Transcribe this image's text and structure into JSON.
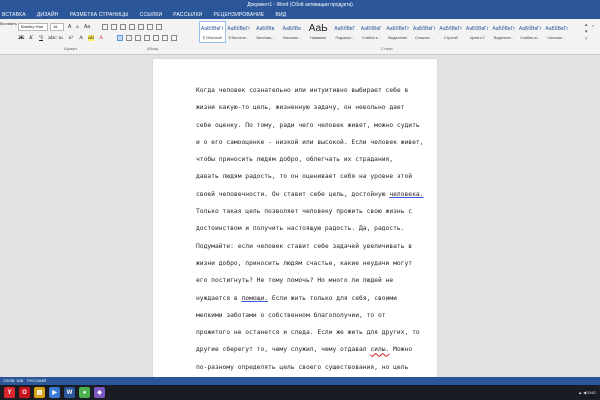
{
  "window": {
    "title": "Документ1 - Word (Сбой активации продукта)"
  },
  "tabs": [
    "ВСТАВКА",
    "ДИЗАЙН",
    "РАЗМЕТКА СТРАНИЦЫ",
    "ССЫЛКИ",
    "РАССЫЛКИ",
    "РЕЦЕНЗИРОВАНИЕ",
    "ВИД"
  ],
  "ribbon": {
    "left_label": "Вставить",
    "font_name": "Bradley Han",
    "font_size": "16",
    "groups": {
      "font": "Шрифт",
      "paragraph": "Абзац",
      "styles": "Стили"
    },
    "styles": [
      {
        "sample": "АаБбВвГг",
        "name": "¶ Обычный",
        "big": false
      },
      {
        "sample": "АаБбВвГг",
        "name": "¶ Без инте...",
        "big": false
      },
      {
        "sample": "АаБбВв",
        "name": "Заголово...",
        "big": false
      },
      {
        "sample": "АаБбВв",
        "name": "Заголово...",
        "big": false
      },
      {
        "sample": "АаЬ",
        "name": "Название",
        "big": true
      },
      {
        "sample": "АаБбВвГ",
        "name": "Подзагол...",
        "big": false
      },
      {
        "sample": "АаБбВвГ",
        "name": "Слабое в...",
        "big": false
      },
      {
        "sample": "АаБбВвГг",
        "name": "Выделение",
        "big": false
      },
      {
        "sample": "АаБбВвГг",
        "name": "Сильное ...",
        "big": false
      },
      {
        "sample": "АаБбВвГг",
        "name": "Строгий",
        "big": false
      },
      {
        "sample": "АаБбВвГг",
        "name": "Цитата 2",
        "big": false
      },
      {
        "sample": "АаБбВвГг",
        "name": "Выделенн...",
        "big": false
      },
      {
        "sample": "АаБбВвГг",
        "name": "Слабая сс...",
        "big": false
      },
      {
        "sample": "АаБбВвГг",
        "name": "Сильная ...",
        "big": false
      }
    ]
  },
  "document": {
    "lines": [
      [
        "Когда человек сознательно или интуитивно выбирает себе в"
      ],
      [
        "жизни какую-то цель, жизненную задачу, он невольно дает"
      ],
      [
        "себе оценку. По тому, ради чего человек живет, можно судить"
      ],
      [
        "и о его самооценке - низкой или высокой. Если человек живет,"
      ],
      [
        "чтобы приносить людям добро, облегчать их страдания,"
      ],
      [
        "давать людям радость, то он оценивает себя на уровне этой"
      ],
      [
        "своей человечности. Он ставит себе цель, достойную ",
        "человека."
      ],
      [
        "Только такая цель позволяет человеку прожить свою жизнь с"
      ],
      [
        "достоинством и получить настоящую радость. Да, радость."
      ],
      [
        "Подумайте: если человек ставит себе задачей увеличивать в"
      ],
      [
        "жизни добро, приносить людям счастье, какие неудачи могут"
      ],
      [
        "его постигнуть? Не тому помочь? Но много ли людей не"
      ],
      [
        "нуждается в ",
        "помощи.",
        " Если жить только для себя, своими"
      ],
      [
        "мелкими заботами о собственном благополучии, то от"
      ],
      [
        "прожитого не останется и следа. Если же жить для других, то"
      ],
      [
        "другие сберегут то, чему служил, чему отдавал ",
        "силы.",
        " Можно"
      ],
      [
        "по-разному определять цель своего существования, но цель"
      ],
      [
        "должна быть."
      ]
    ]
  },
  "status": {
    "page_info": "СЛОВ: 348",
    "language": "РУССКИЙ"
  },
  "taskbar": {
    "icons": [
      {
        "name": "yandex-icon",
        "glyph": "Y",
        "color": "#d9272e"
      },
      {
        "name": "opera-icon",
        "glyph": "O",
        "color": "#c8141f"
      },
      {
        "name": "file-explorer-icon",
        "glyph": "▤",
        "color": "#d9a21b"
      },
      {
        "name": "media-icon",
        "glyph": "▶",
        "color": "#3a7bd5"
      },
      {
        "name": "word-icon",
        "glyph": "W",
        "color": "#2b579a"
      },
      {
        "name": "chrome-icon",
        "glyph": "●",
        "color": "#4caf50"
      },
      {
        "name": "app-icon",
        "glyph": "◆",
        "color": "#7b57c2"
      }
    ],
    "tray": "▲ ◀ ENG"
  }
}
